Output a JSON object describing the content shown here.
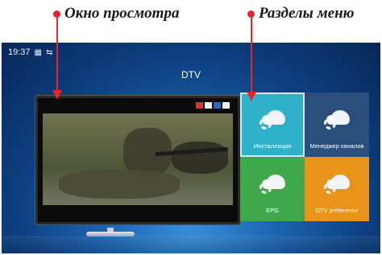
{
  "annotations": {
    "left_label": "Окно просмотра",
    "right_label": "Разделы меню",
    "accent_color": "#e8222e"
  },
  "statusbar": {
    "time": "19:37",
    "icons": [
      "picture-icon",
      "usb-icon"
    ]
  },
  "screen": {
    "title": "DTV"
  },
  "menu": {
    "tiles": [
      {
        "label": "Инсталляция",
        "color": "#2fb2c9",
        "icon": "cloud-gear-icon"
      },
      {
        "label": "Менеджер каналов",
        "color": "#2a4f7d",
        "icon": "cloud-gear-icon"
      },
      {
        "label": "EPG",
        "color": "#3fa84b",
        "icon": "cloud-gear-icon"
      },
      {
        "label": "DTV preference",
        "color": "#e8941a",
        "icon": "cloud-gear-icon"
      }
    ]
  }
}
